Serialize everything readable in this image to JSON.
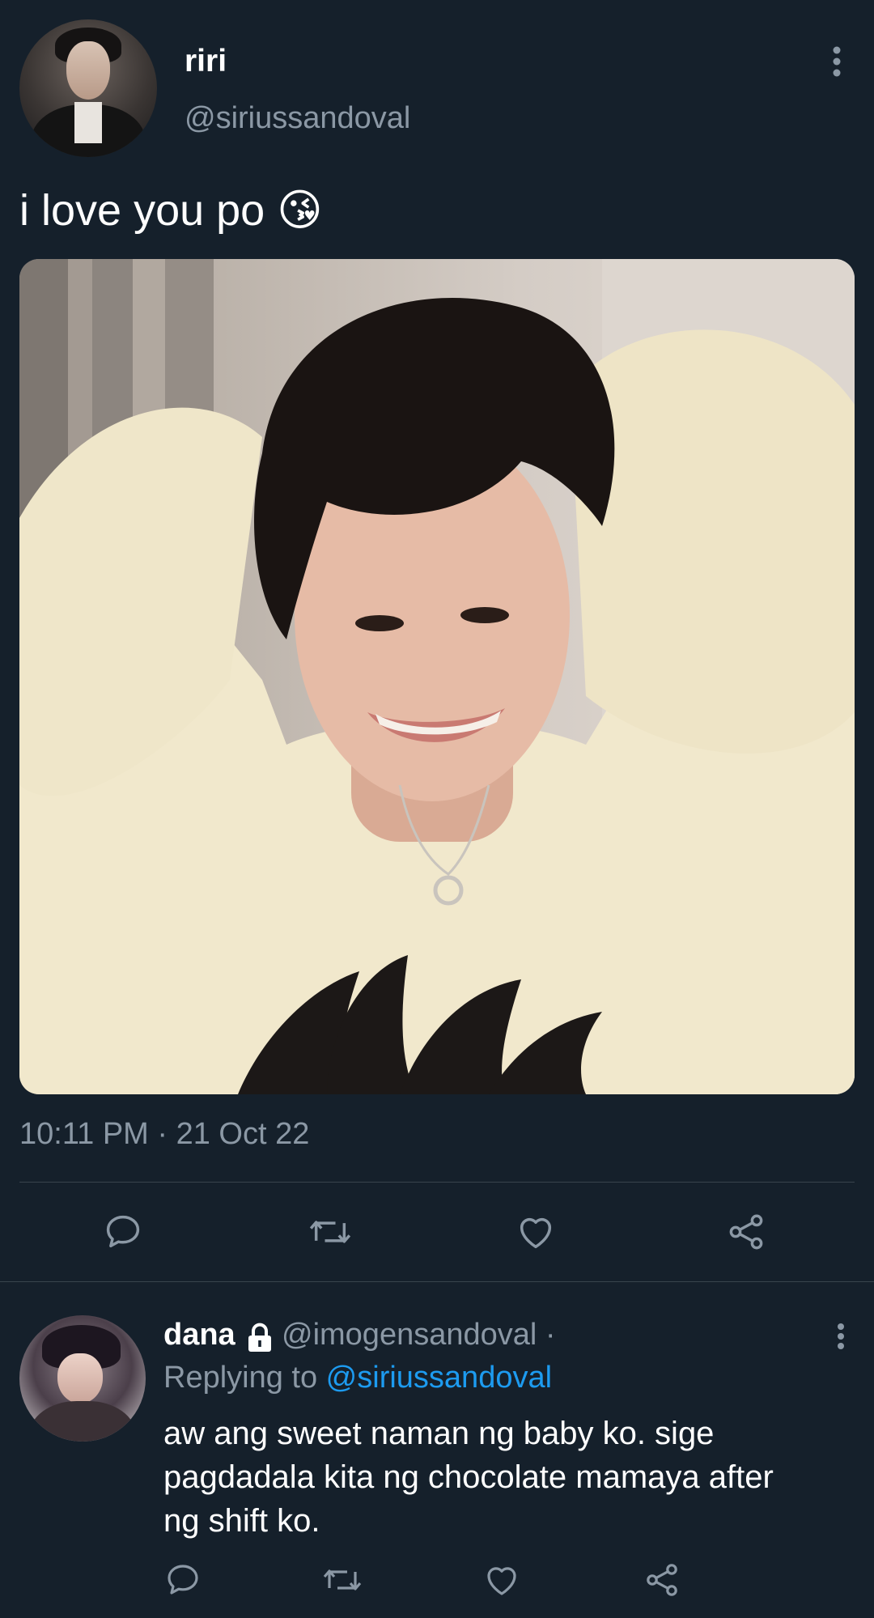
{
  "tweet": {
    "display_name": "riri",
    "handle": "@siriussandoval",
    "text": "i love you po 😘",
    "timestamp": "10:11 PM · 21 Oct 22",
    "media_alt": "photo of person in cream sweater with hands on head"
  },
  "reply": {
    "display_name": "dana",
    "handle": "@imogensandoval ·",
    "replying_prefix": "Replying to ",
    "replying_handle": "@siriussandoval",
    "text_line1": "aw ang sweet naman ng baby ko. sige",
    "text_line2": "pagdadala kita ng chocolate mamaya after",
    "text_line3": "ng shift ko."
  },
  "icons": {
    "more": "more-vertical-icon",
    "reply": "reply-icon",
    "retweet": "retweet-icon",
    "like": "heart-icon",
    "share": "share-icon",
    "lock": "lock-icon"
  },
  "colors": {
    "background": "#15202b",
    "muted_text": "#8b98a5",
    "link": "#1d9bf0",
    "divider": "#38444d"
  }
}
